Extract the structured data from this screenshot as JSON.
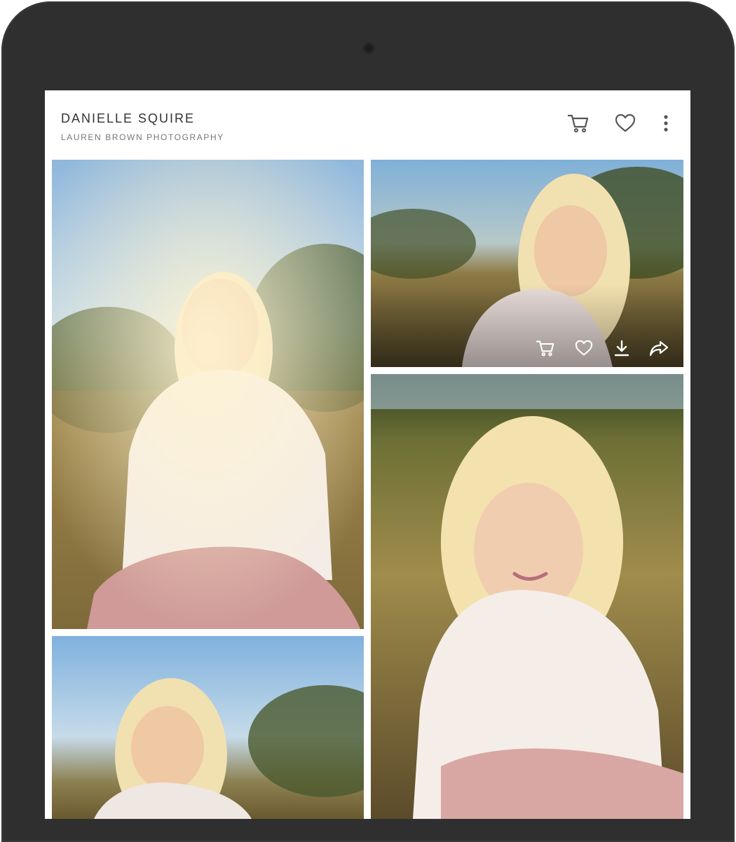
{
  "gallery": {
    "title": "DANIELLE SQUIRE",
    "subtitle": "LAUREN BROWN PHOTOGRAPHY"
  },
  "header_icons": [
    "cart-icon",
    "heart-icon",
    "more-vertical-icon"
  ],
  "photo_actions": [
    "cart-icon",
    "heart-icon",
    "download-icon",
    "share-icon"
  ],
  "colors": {
    "device_frame": "#2f2f2f",
    "title_text": "#333333",
    "subtitle_text": "#777777",
    "icon_gray": "#555555"
  }
}
